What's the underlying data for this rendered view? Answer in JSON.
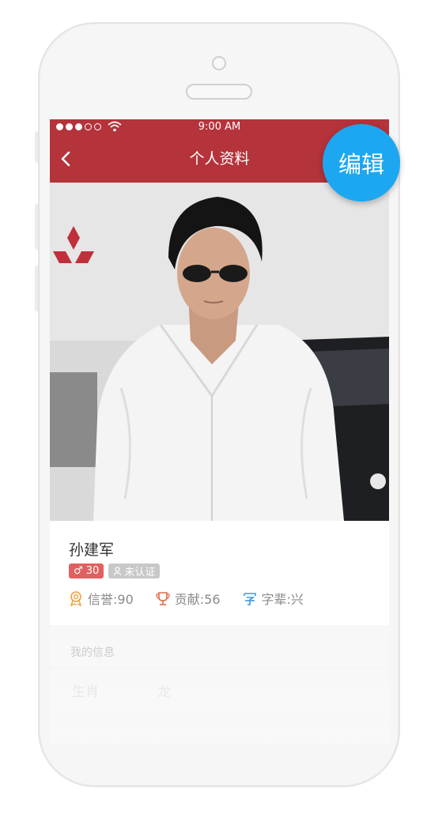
{
  "status_bar": {
    "time": "9:00 AM",
    "signal_bars_filled": 3,
    "signal_bars_total": 5
  },
  "nav": {
    "title": "个人资料"
  },
  "profile": {
    "name": "孙建军",
    "gender_badge": "♂ 30",
    "verify_badge": "未认证",
    "stats": [
      {
        "label": "信誉:90",
        "icon": "medal-icon",
        "color": "#f0a040"
      },
      {
        "label": "贡献:56",
        "icon": "trophy-icon",
        "color": "#e06a4a"
      },
      {
        "label": "字辈:兴",
        "icon": "character-icon",
        "color": "#3a9be0"
      }
    ]
  },
  "info": {
    "section_title": "我的信息",
    "rows": [
      {
        "label": "生肖",
        "value": "龙"
      }
    ]
  },
  "edit_button": {
    "label": "编辑"
  },
  "colors": {
    "nav": "#b5333b",
    "edit": "#1da7f0"
  }
}
